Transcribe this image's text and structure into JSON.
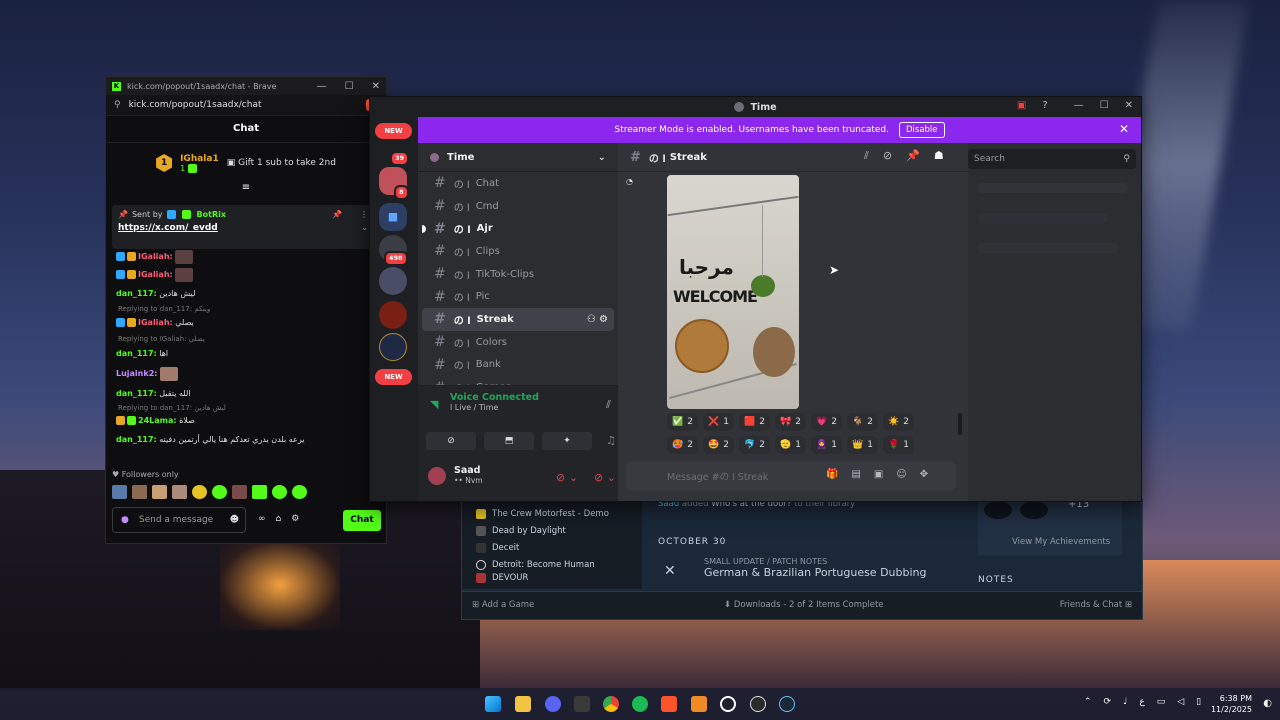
{
  "brave": {
    "title": "kick.com/popout/1saadx/chat - Brave",
    "url": "kick.com/popout/1saadx/chat",
    "chat_title": "Chat",
    "gifter_name": "IGhala1",
    "gifter_count": "1",
    "gift_cta": "Gift 1 sub to take 2nd",
    "pinned": {
      "sent_by": "Sent by",
      "sender": "BotRix",
      "link": "https://x.com/_evdd"
    },
    "messages": [
      {
        "user": "IGaliah:",
        "text": ""
      },
      {
        "user": "IGaliah:",
        "text": ""
      },
      {
        "user": "dan_117:",
        "text": "ليش هادين"
      },
      {
        "reply": "Replying to dan_117: وينكم"
      },
      {
        "user": "IGaliah:",
        "text": "يصلي"
      },
      {
        "reply": "Replying to IGaliah: يصلي"
      },
      {
        "user": "dan_117:",
        "text": "اها"
      },
      {
        "user": "Lujaink2:",
        "text": ""
      },
      {
        "user": "dan_117:",
        "text": "الله يتقبل"
      },
      {
        "reply": "Replying to dan_117: ليش هادين"
      },
      {
        "user": "24Lama:",
        "text": "صلاة"
      },
      {
        "user": "dan_117:",
        "text": "يرعه بلدن بدري تعدكم هنا يالي أرتمين دفيته"
      }
    ],
    "followers_only": "Followers only",
    "input_placeholder": "Send a message",
    "chat_button": "Chat"
  },
  "steam": {
    "games": [
      "The Crew Motorfest - Demo",
      "Dead by Daylight",
      "Deceit",
      "Detroit: Become Human",
      "DEVOUR"
    ],
    "activity_user": "Saad",
    "activity_added": "added",
    "activity_game": "Who's at the door?",
    "activity_suffix": "to their library",
    "date_header": "OCTOBER 30",
    "update_tag": "SMALL UPDATE / PATCH NOTES",
    "update_title": "German & Brazilian Portuguese Dubbing",
    "achievements_more": "+13",
    "view_achievements": "View My Achievements",
    "notes": "NOTES",
    "add_game": "Add a Game",
    "downloads": "Downloads - 2 of 2 Items Complete",
    "friends_chat": "Friends & Chat"
  },
  "discord": {
    "window_title": "Time",
    "banner_text": "Streamer Mode is enabled. Usernames have been truncated.",
    "banner_button": "Disable",
    "server_name": "Time",
    "new_label": "NEW",
    "badges": {
      "a": "39",
      "b": "8",
      "c": "498"
    },
    "channels": [
      {
        "name": "Chat",
        "state": "normal"
      },
      {
        "name": "Cmd",
        "state": "normal"
      },
      {
        "name": "Ajr",
        "state": "unread"
      },
      {
        "name": "Clips",
        "state": "normal"
      },
      {
        "name": "TikTok-Clips",
        "state": "normal"
      },
      {
        "name": "Pic",
        "state": "normal"
      },
      {
        "name": "Streak",
        "state": "active"
      },
      {
        "name": "Colors",
        "state": "normal"
      },
      {
        "name": "Bank",
        "state": "normal"
      },
      {
        "name": "Games",
        "state": "normal"
      }
    ],
    "channel_prefix": "の ا",
    "voice_status": "Voice Connected",
    "voice_channel": "Live / Time",
    "user_name": "Saad",
    "user_status": "Nvm",
    "current_channel": "Streak",
    "search_placeholder": "Search",
    "message_placeholder": "Message #の ا Streak",
    "photo_text_ar": "مرحبا",
    "photo_text_en": "WELCOME",
    "reactions_row1": [
      {
        "emoji": "✅",
        "count": "2"
      },
      {
        "emoji": "❌",
        "count": "1"
      },
      {
        "emoji": "🟥",
        "count": "2"
      },
      {
        "emoji": "🎀",
        "count": "2"
      },
      {
        "emoji": "💗",
        "count": "2"
      },
      {
        "emoji": "🐐",
        "count": "2"
      },
      {
        "emoji": "☀️",
        "count": "2"
      }
    ],
    "reactions_row2": [
      {
        "emoji": "🥵",
        "count": "2"
      },
      {
        "emoji": "🤩",
        "count": "2"
      },
      {
        "emoji": "🐬",
        "count": "2"
      },
      {
        "emoji": "🫡",
        "count": "1"
      },
      {
        "emoji": "🧕",
        "count": "1"
      },
      {
        "emoji": "👑",
        "count": "1"
      },
      {
        "emoji": "🌹",
        "count": "1"
      }
    ]
  },
  "taskbar": {
    "time": "6:38 PM",
    "date": "11/2/2025",
    "lang": "ع"
  }
}
